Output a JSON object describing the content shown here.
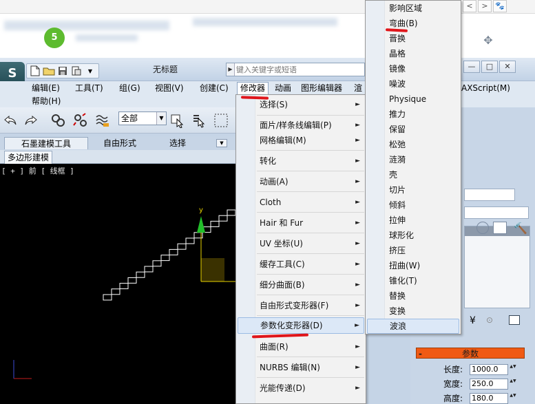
{
  "browser": {
    "badge": "5",
    "nav": {
      "prev": "<",
      "next": ">",
      "ext": "🐾"
    }
  },
  "app": {
    "logo": "S",
    "document_title": "无标题",
    "search_placeholder": "键入关键字或短语",
    "window_controls": {
      "minimize": "—",
      "restore": "□",
      "close": "✕"
    }
  },
  "menubar": {
    "items": [
      "编辑(E)",
      "工具(T)",
      "组(G)",
      "视图(V)",
      "创建(C)",
      "修改器",
      "动画",
      "图形编辑器",
      "渲",
      "AXScript(M)"
    ],
    "help": "帮助(H)"
  },
  "toolbar": {
    "selection_filter": "全部",
    "dropdown_arrow": "▼"
  },
  "ribbon": {
    "tabs": [
      "石墨建模工具",
      "自由形式",
      "选择"
    ],
    "sub_tab": "多边形建模",
    "dropdown_arrow": "▼"
  },
  "viewport": {
    "label": "[ + ] 前 [ 线框 ]",
    "gizmo_y_label": "y"
  },
  "modifiers_menu": {
    "submenu_arrow": "►",
    "items": [
      {
        "label": "选择(S)",
        "has_sub": true
      },
      {
        "label": "面片/样条线编辑(P)",
        "has_sub": true
      },
      {
        "label": "网格编辑(M)",
        "has_sub": true
      },
      {
        "label": "转化",
        "has_sub": true
      },
      {
        "label": "动画(A)",
        "has_sub": true
      },
      {
        "label": "Cloth",
        "has_sub": true
      },
      {
        "label": "Hair 和 Fur",
        "has_sub": true
      },
      {
        "label": "UV 坐标(U)",
        "has_sub": true
      },
      {
        "label": "缓存工具(C)",
        "has_sub": true
      },
      {
        "label": "细分曲面(B)",
        "has_sub": true
      },
      {
        "label": "自由形式变形器(F)",
        "has_sub": true
      },
      {
        "label": "参数化变形器(D)",
        "has_sub": true,
        "highlighted": true
      },
      {
        "label": "曲面(R)",
        "has_sub": true
      },
      {
        "label": "NURBS 编辑(N)",
        "has_sub": true
      },
      {
        "label": "光能传递(D)",
        "has_sub": true
      }
    ]
  },
  "parametric_submenu": {
    "items": [
      {
        "label": "影响区域"
      },
      {
        "label": "弯曲(B)"
      },
      {
        "label": "晋换"
      },
      {
        "label": "晶格"
      },
      {
        "label": "镜像"
      },
      {
        "label": "噪波"
      },
      {
        "label": "Physique"
      },
      {
        "label": "推力"
      },
      {
        "label": "保留"
      },
      {
        "label": "松弛"
      },
      {
        "label": "涟漪"
      },
      {
        "label": "壳"
      },
      {
        "label": "切片"
      },
      {
        "label": "倾斜"
      },
      {
        "label": "拉伸"
      },
      {
        "label": "球形化"
      },
      {
        "label": "挤压"
      },
      {
        "label": "扭曲(W)"
      },
      {
        "label": "锥化(T)"
      },
      {
        "label": "替换"
      },
      {
        "label": "变换"
      },
      {
        "label": "波浪",
        "highlighted": true
      }
    ]
  },
  "command_panel": {
    "rollout_title": "参数",
    "collapse_sign": "-",
    "spinner": "▲▼",
    "params": [
      {
        "label": "长度:",
        "value": "1000.0"
      },
      {
        "label": "宽度:",
        "value": "250.0"
      },
      {
        "label": "高度:",
        "value": "180.0"
      }
    ]
  },
  "colors": {
    "annotation_red": "#e0161b",
    "rollout_orange": "#f05a14",
    "gizmo_green": "#22c02a",
    "gizmo_yellow": "#e8d400",
    "stairs": "#ffffff"
  }
}
